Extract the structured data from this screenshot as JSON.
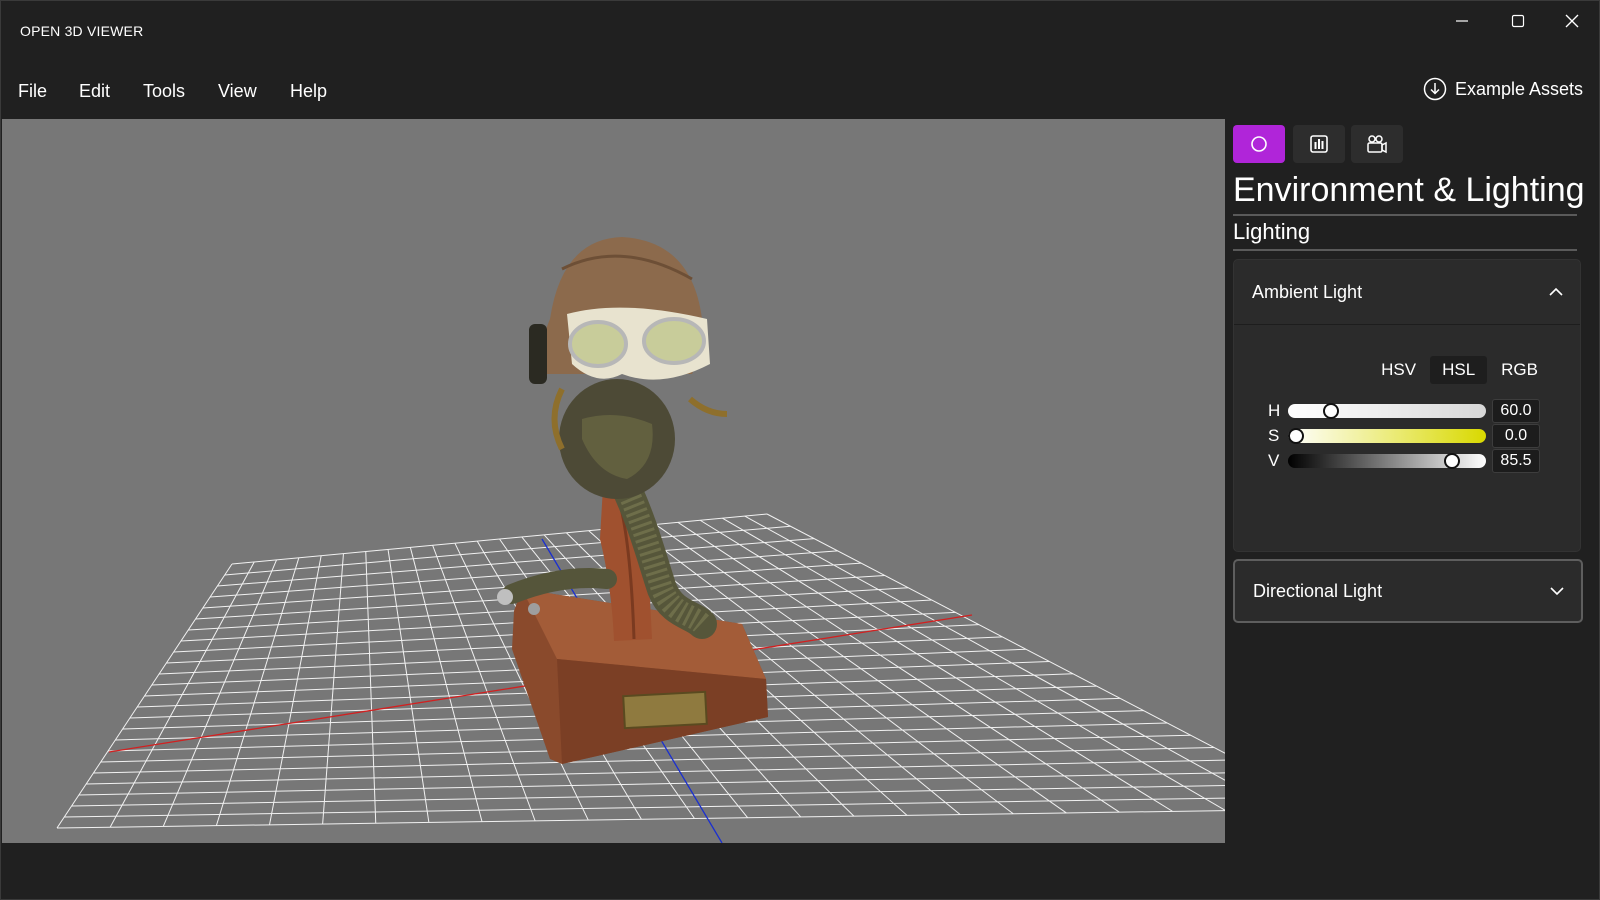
{
  "app": {
    "title": "OPEN 3D VIEWER"
  },
  "window_controls": {
    "minimize_icon": "minimize-icon",
    "maximize_icon": "maximize-icon",
    "close_icon": "close-icon"
  },
  "menu": {
    "items": [
      "File",
      "Edit",
      "Tools",
      "View",
      "Help"
    ],
    "example_assets": "Example Assets",
    "example_assets_icon": "download-circle-icon"
  },
  "panel": {
    "tabs": [
      {
        "icon": "environment-icon",
        "active": true
      },
      {
        "icon": "stats-icon",
        "active": false
      },
      {
        "icon": "camera-icon",
        "active": false
      }
    ],
    "accent": "#b025d9",
    "title": "Environment & Lighting",
    "section": "Lighting",
    "ambient": {
      "label": "Ambient Light",
      "expanded": true,
      "modes": [
        "HSV",
        "HSL",
        "RGB"
      ],
      "active_mode": "HSL",
      "sliders": [
        {
          "label": "H",
          "value": "60.0",
          "fraction": 0.19
        },
        {
          "label": "S",
          "value": "0.0",
          "fraction": 0.0
        },
        {
          "label": "V",
          "value": "85.5",
          "fraction": 0.855
        }
      ]
    },
    "directional": {
      "label": "Directional Light",
      "expanded": false
    }
  },
  "viewport": {
    "background": "#777777",
    "grid_color": "#ffffff",
    "x_axis_color": "#d22020",
    "z_axis_color": "#1a2fd0"
  }
}
